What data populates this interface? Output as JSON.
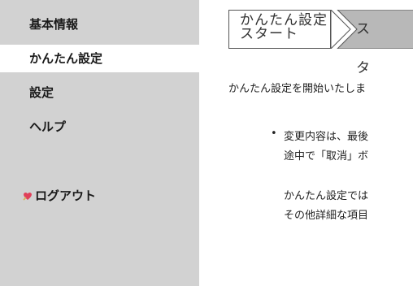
{
  "sidebar": {
    "items": [
      {
        "label": "基本情報"
      },
      {
        "label": "かんたん設定"
      },
      {
        "label": "設定"
      },
      {
        "label": "ヘルプ"
      }
    ],
    "logout": {
      "label": "ログアウト",
      "icon": "logout-heart-icon",
      "icon_color": "#e0405a"
    }
  },
  "main": {
    "steps": {
      "current_line1": "かんたん設定",
      "current_line2": "スタート",
      "next_partial": "スタ"
    },
    "intro": "かんたん設定を開始いたしま",
    "bullet": {
      "line1": "変更内容は、最後",
      "line2": "途中で「取消」ボ"
    },
    "para": {
      "line1": "かんたん設定では",
      "line2": "その他詳細な項目"
    }
  },
  "colors": {
    "sidebar_bg": "#d2d2d2",
    "active_bg": "#ffffff",
    "step_next_bg": "#b8b8b8"
  }
}
